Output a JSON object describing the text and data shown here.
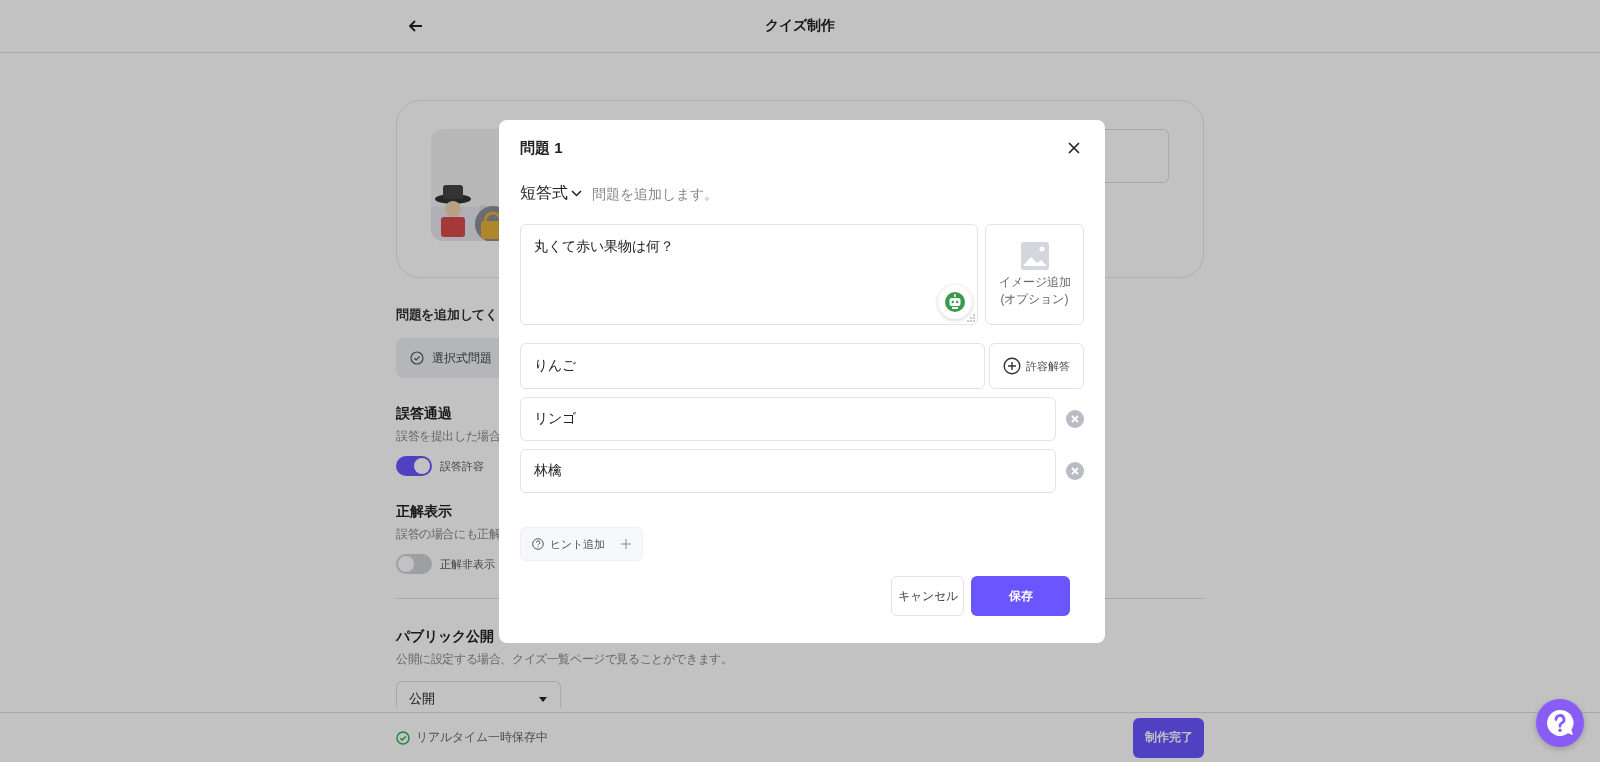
{
  "header": {
    "title": "クイズ制作"
  },
  "page": {
    "section_heading": "問題を追加してく",
    "question_type_chip": "選択式問題",
    "settings": [
      {
        "title": "誤答通過",
        "description": "誤答を提出した場合",
        "toggle_label": "誤答許容",
        "on": true
      },
      {
        "title": "正解表示",
        "description": "誤答の場合にも正解",
        "toggle_label": "正解非表示",
        "on": false
      }
    ],
    "public": {
      "title": "パブリック公開",
      "description": "公開に設定する場合、クイズ一覧ページで見ることができます。",
      "select_value": "公開"
    }
  },
  "bottom_bar": {
    "status": "リアルタイム一時保存中",
    "finish_button": "制作完了"
  },
  "modal": {
    "title": "問題 1",
    "question_type": "短答式",
    "title_placeholder": "問題を追加します。",
    "question_text": "丸くて赤い果物は何？",
    "image_label": [
      "イメージ追加",
      "(オプション)"
    ],
    "answer": "りんご",
    "allowed_answer_button": "許容解答",
    "allowed_answers": [
      "リンゴ",
      "林檎"
    ],
    "hint_button": "ヒント追加",
    "cancel_button": "キャンセル",
    "save_button": "保存"
  }
}
